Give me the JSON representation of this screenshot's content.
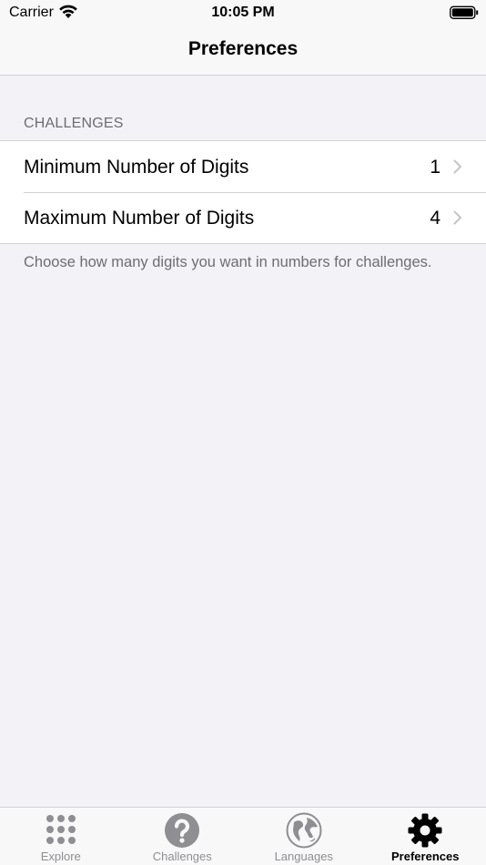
{
  "status_bar": {
    "carrier": "Carrier",
    "time": "10:05 PM"
  },
  "nav": {
    "title": "Preferences"
  },
  "section": {
    "header": "CHALLENGES",
    "rows": [
      {
        "label": "Minimum Number of Digits",
        "value": "1"
      },
      {
        "label": "Maximum Number of Digits",
        "value": "4"
      }
    ],
    "footer": "Choose how many digits you want in numbers for challenges."
  },
  "tab_bar": {
    "tabs": [
      {
        "label": "Explore",
        "icon": "grid-dots-icon"
      },
      {
        "label": "Challenges",
        "icon": "question-circle-icon"
      },
      {
        "label": "Languages",
        "icon": "globe-icon"
      },
      {
        "label": "Preferences",
        "icon": "gear-icon",
        "active": true
      }
    ]
  },
  "colors": {
    "background": "#f2f2f7",
    "inactive_tab": "#8e8e93",
    "active_tab": "#000000",
    "secondary_text": "#6d6d72"
  }
}
